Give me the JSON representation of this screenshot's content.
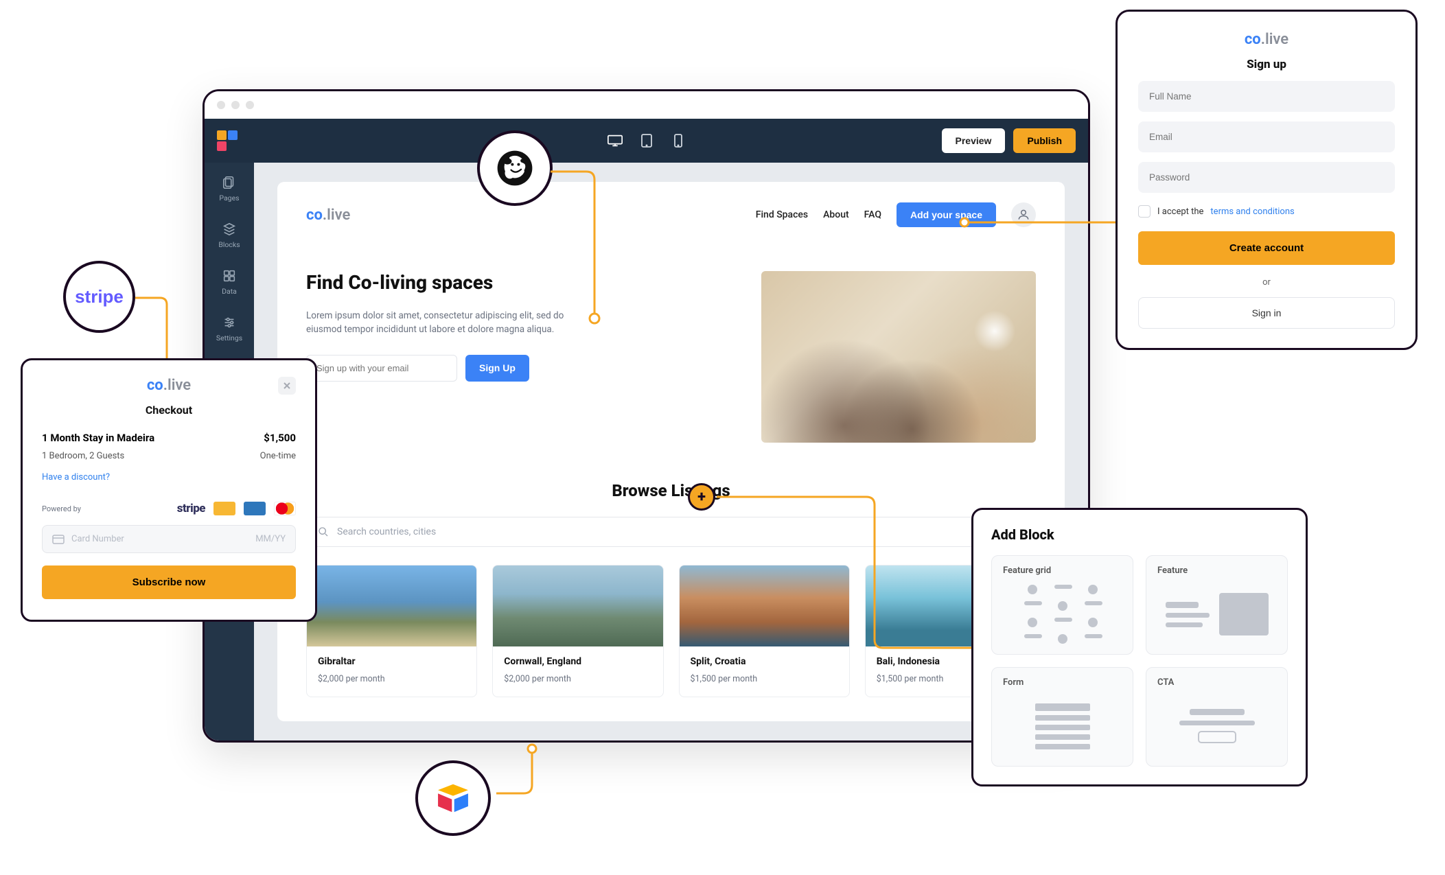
{
  "builder": {
    "topbar": {
      "preview": "Preview",
      "publish": "Publish"
    },
    "sidenav": {
      "pages": "Pages",
      "blocks": "Blocks",
      "data": "Data",
      "settings": "Settings"
    }
  },
  "site": {
    "brand_co": "co",
    "brand_live": ".live",
    "nav": {
      "find_spaces": "Find Spaces",
      "about": "About",
      "faq": "FAQ",
      "add_space": "Add your space"
    },
    "hero": {
      "title": "Find Co-living spaces",
      "subtitle": "Lorem ipsum dolor sit amet, consectetur adipiscing elit, sed do eiusmod tempor incididunt ut labore et dolore magna aliqua.",
      "email_placeholder": "Sign up with your email",
      "signup_btn": "Sign Up"
    },
    "browse": {
      "title": "Browse Listings",
      "search_placeholder": "Search countries, cities"
    },
    "listings": [
      {
        "title": "Gibraltar",
        "price": "$2,000 per month"
      },
      {
        "title": "Cornwall, England",
        "price": "$2,000 per month"
      },
      {
        "title": "Split, Croatia",
        "price": "$1,500 per month"
      },
      {
        "title": "Bali, Indonesia",
        "price": "$1,500 per month"
      }
    ]
  },
  "checkout": {
    "brand_co": "co",
    "brand_live": ".live",
    "title": "Checkout",
    "item": "1 Month Stay in Madeira",
    "price": "$1,500",
    "detail": "1 Bedroom, 2 Guests",
    "frequency": "One-time",
    "discount": "Have a discount?",
    "powered_by": "Powered by",
    "stripe_word": "stripe",
    "card_placeholder": "Card Number",
    "exp_placeholder": "MM/YY",
    "subscribe": "Subscribe now"
  },
  "signup": {
    "brand_co": "co",
    "brand_live": ".live",
    "title": "Sign up",
    "fullname_ph": "Full Name",
    "email_ph": "Email",
    "password_ph": "Password",
    "accept_pre": "I accept the ",
    "accept_link": "terms and conditions",
    "create": "Create account",
    "or": "or",
    "signin": "Sign in"
  },
  "addblock": {
    "title": "Add Block",
    "feature_grid": "Feature grid",
    "feature": "Feature",
    "form": "Form",
    "cta": "CTA"
  },
  "bubbles": {
    "stripe": "stripe"
  }
}
